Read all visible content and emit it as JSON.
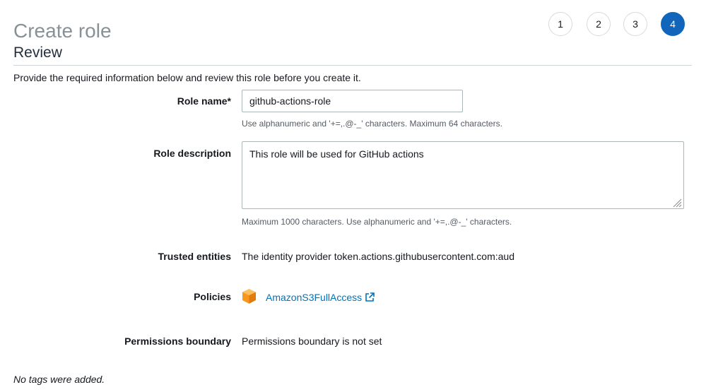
{
  "header": {
    "title": "Create role",
    "steps": [
      {
        "label": "1",
        "active": false
      },
      {
        "label": "2",
        "active": false
      },
      {
        "label": "3",
        "active": false
      },
      {
        "label": "4",
        "active": true
      }
    ]
  },
  "review": {
    "title": "Review",
    "intro": "Provide the required information below and review this role before you create it.",
    "role_name": {
      "label": "Role name*",
      "value": "github-actions-role",
      "hint": "Use alphanumeric and '+=,.@-_' characters. Maximum 64 characters."
    },
    "role_description": {
      "label": "Role description",
      "value": "This role will be used for GitHub actions",
      "hint": "Maximum 1000 characters. Use alphanumeric and '+=,.@-_' characters."
    },
    "trusted_entities": {
      "label": "Trusted entities",
      "value": "The identity provider token.actions.githubusercontent.com:aud"
    },
    "policies": {
      "label": "Policies",
      "items": [
        {
          "name": "AmazonS3FullAccess",
          "icon": "aws-managed-policy-cube-icon"
        }
      ]
    },
    "permissions_boundary": {
      "label": "Permissions boundary",
      "value": "Permissions boundary is not set"
    },
    "tags_note": "No tags were added."
  },
  "colors": {
    "accent": "#1166bb",
    "link": "#0073bb",
    "policy_icon": "#f7981d"
  }
}
